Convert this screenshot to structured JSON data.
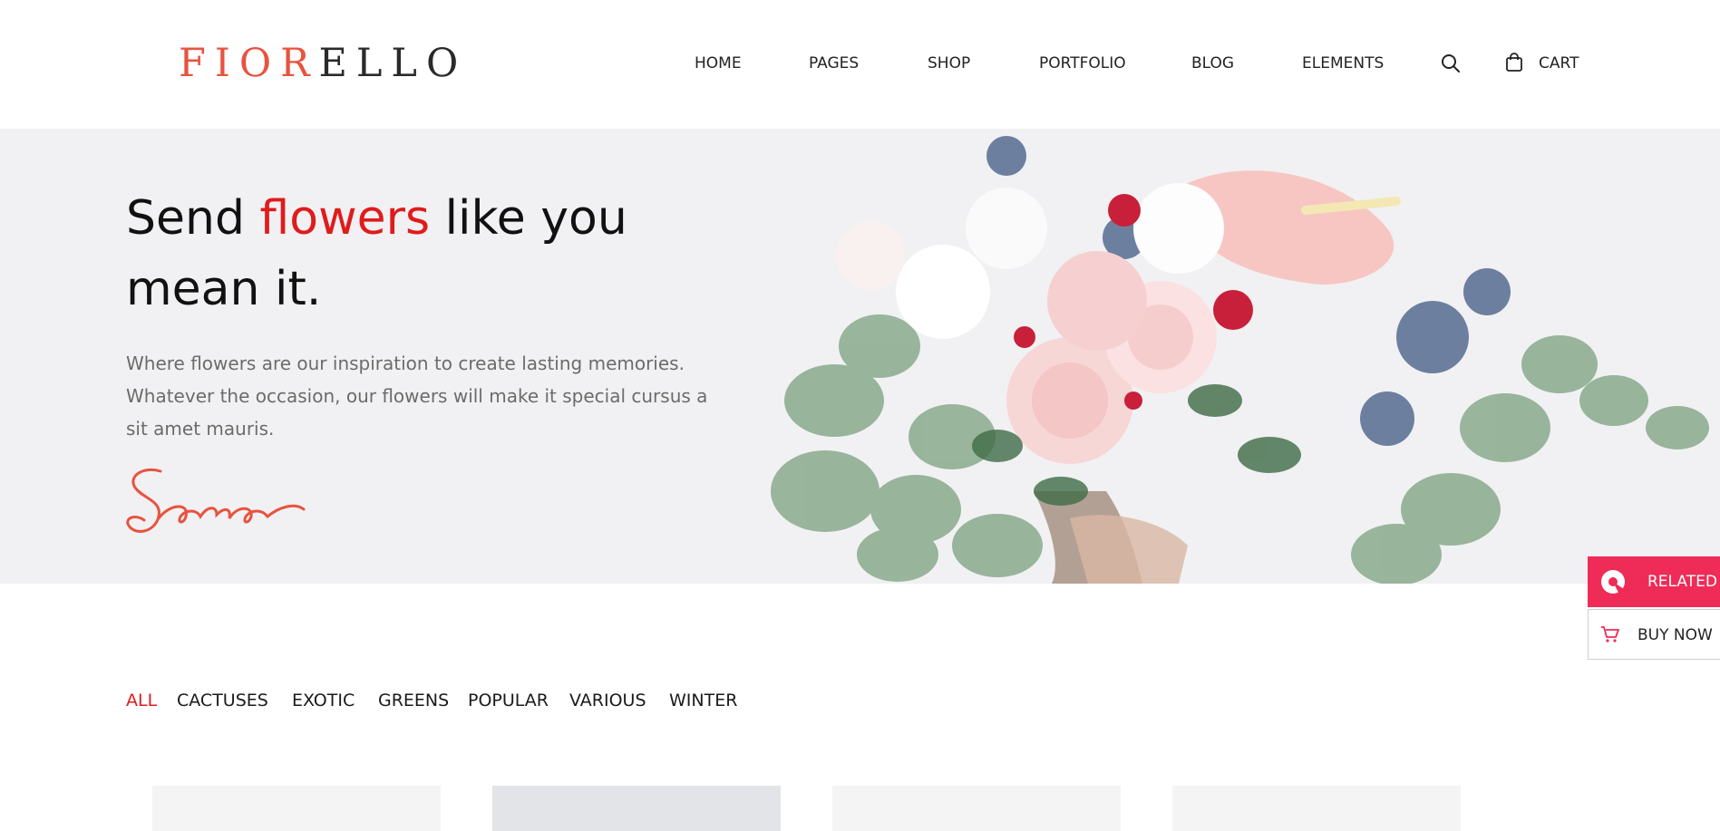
{
  "header": {
    "logo": {
      "part1": "FIOR",
      "part2": "ELLO"
    },
    "nav": [
      "HOME",
      "PAGES",
      "SHOP",
      "PORTFOLIO",
      "BLOG",
      "ELEMENTS"
    ],
    "search_icon": "search-icon",
    "cart_icon": "shopping-bag-icon",
    "cart_label": "CART"
  },
  "hero": {
    "title_prefix": "Send ",
    "title_accent": "flowers",
    "title_suffix": " like you mean it.",
    "description": "Where flowers are our inspiration to create lasting memories. Whatever the occasion, our flowers will make it special cursus a sit amet mauris.",
    "signature": "Sara"
  },
  "filters": [
    "ALL",
    "CACTUSES",
    "EXOTIC",
    "GREENS",
    "POPULAR",
    "VARIOUS",
    "WINTER"
  ],
  "active_filter": "ALL",
  "side_panel": {
    "related_label": "RELATED",
    "buy_label": "BUY NOW"
  },
  "colors": {
    "accent_red": "#e01b1b",
    "logo_coral": "#e8533f",
    "side_pink": "#ef2b57",
    "hero_bg": "#f1f1f3"
  }
}
